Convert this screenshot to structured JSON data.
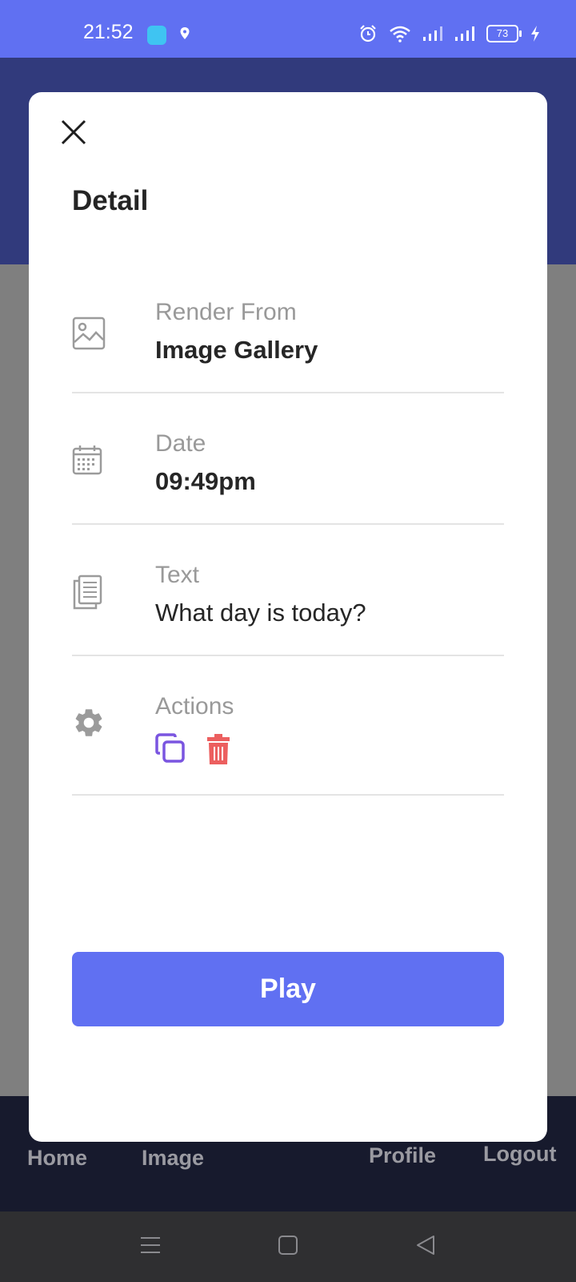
{
  "status_bar": {
    "time": "21:52",
    "battery": "73",
    "icons": [
      "touch-icon",
      "location-icon",
      "alarm-icon",
      "wifi-icon",
      "signal-icon",
      "signal-icon",
      "battery-icon",
      "charging-icon"
    ]
  },
  "bottom_nav": {
    "items": [
      {
        "label": "Home",
        "icon": "home-icon"
      },
      {
        "label": "Image",
        "icon": "image-icon"
      },
      {
        "label": "Profile",
        "icon": "profile-icon"
      },
      {
        "label": "Logout",
        "icon": "logout-icon"
      }
    ]
  },
  "modal": {
    "title": "Detail",
    "close_icon": "close-icon",
    "rows": [
      {
        "icon": "image-icon",
        "label": "Render From",
        "value": "Image Gallery"
      },
      {
        "icon": "calendar-icon",
        "label": "Date",
        "value": "09:49pm"
      },
      {
        "icon": "document-icon",
        "label": "Text",
        "value": "What day is today?"
      },
      {
        "icon": "gear-icon",
        "label": "Actions"
      }
    ],
    "actions": [
      {
        "icon": "copy-icon",
        "color": "#7a55e0"
      },
      {
        "icon": "trash-icon",
        "color": "#ec5f5f"
      }
    ],
    "play_label": "Play"
  },
  "colors": {
    "accent": "#6070f2",
    "header": "#313a7c",
    "overlay": "#7f7f7f",
    "nav": "#171a2d",
    "danger": "#ec5f5f",
    "copy": "#7a55e0"
  }
}
